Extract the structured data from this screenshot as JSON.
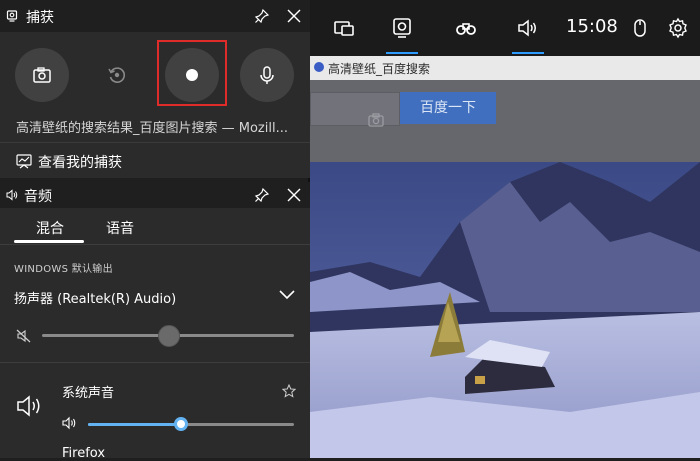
{
  "capture": {
    "title": "捕获",
    "window_title": "高清壁纸的搜索结果_百度图片搜索 — Mozill...",
    "gallery_link": "查看我的捕获",
    "highlight_color": "#e02b2b"
  },
  "topbar": {
    "time": "15:08",
    "accent": "#2e9bff"
  },
  "audio": {
    "title": "音频",
    "tabs": [
      {
        "label": "混合"
      },
      {
        "label": "语音"
      }
    ],
    "output_label": "WINDOWS 默认输出",
    "device": "扬声器 (Realtek(R) Audio)",
    "master_level": 0.5,
    "system_sounds_label": "系统声音",
    "system_level": 0.45,
    "next_app": "Firefox",
    "slider_color": "#63b3f2"
  },
  "browser": {
    "tab_title": "高清壁纸_百度搜索",
    "search_button": "百度一下"
  }
}
